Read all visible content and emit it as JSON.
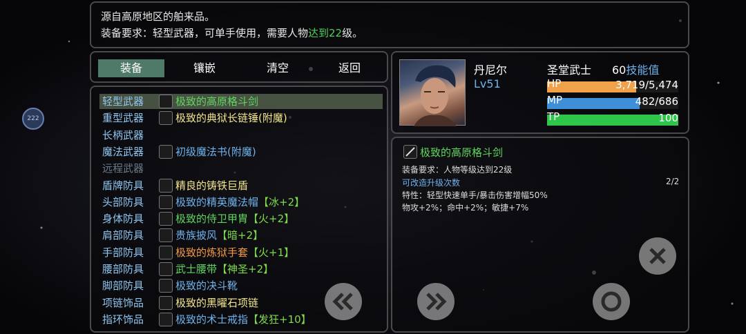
{
  "description": {
    "line1": "源自高原地区的舶来品。",
    "line2_prefix": "装备要求：轻型武器，可单手使用，需要人物",
    "line2_green": "达到22",
    "line2_suffix": "级。"
  },
  "tabs": {
    "equip": "装备",
    "inlay": "镶嵌",
    "clear": "清空",
    "back": "返回"
  },
  "side_badge": "222",
  "slots": [
    {
      "slot": "轻型武器",
      "item": "极致的高原格斗剑",
      "color": "c-green"
    },
    {
      "slot": "重型武器",
      "item": "极致的典狱长链锤(附魔)",
      "color": "c-yellow"
    },
    {
      "slot": "长柄武器",
      "item": "",
      "color": "c-white"
    },
    {
      "slot": "魔法武器",
      "item": "初级魔法书(附魔)",
      "color": "c-blue"
    },
    {
      "slot": "远程武器",
      "item": "",
      "color": "c-white"
    },
    {
      "slot": "盾牌防具",
      "item": "精良的铸铁巨盾",
      "color": "c-yellow"
    },
    {
      "slot": "头部防具",
      "item": "极致的精英魔法帽",
      "suffix": "【冰+2】",
      "color": "c-blue"
    },
    {
      "slot": "身体防具",
      "item": "极致的侍卫甲胄",
      "suffix": "【火+2】",
      "color": "c-green"
    },
    {
      "slot": "肩部防具",
      "item": "贵族披风",
      "suffix": "【暗+2】",
      "color": "c-blue"
    },
    {
      "slot": "手部防具",
      "item": "极致的炼狱手套",
      "suffix": "【火+1】",
      "color": "c-orange"
    },
    {
      "slot": "腰部防具",
      "item": "武士腰带",
      "suffix": "【神圣+2】",
      "color": "c-green"
    },
    {
      "slot": "脚部防具",
      "item": "极致的决斗靴",
      "color": "c-blue"
    },
    {
      "slot": "项链饰品",
      "item": "极致的黑曜石项链",
      "color": "c-yellow"
    },
    {
      "slot": "指环饰品",
      "item": "极致的术士戒指",
      "suffix": "【发狂+10】",
      "color": "c-blue"
    }
  ],
  "character": {
    "name": "丹尼尔",
    "class": "圣堂武士",
    "skill_points": "60",
    "skill_label": "技能值",
    "level": "Lv51",
    "hp_label": "HP",
    "hp_value": "3,719/5,474",
    "hp_ratio": 0.679,
    "mp_label": "MP",
    "mp_value": "482/686",
    "mp_ratio": 0.703,
    "tp_label": "TP",
    "tp_value": "100",
    "tp_ratio": 1.0
  },
  "detail": {
    "item_name": "极致的高原格斗剑",
    "requirement": "装备要求：人物等级达到22级",
    "upgrade_label": "可改造升级次数",
    "upgrade_count": "2/2",
    "trait": "特性：轻型快速单手/暴击伤害增幅50%",
    "stats": "物攻+2%；命中+2%；敏捷+7%"
  },
  "colors": {
    "hp_bar": "#f0a24a",
    "mp_bar": "#3f8fd8",
    "tp_bar": "#2fc44a",
    "tab_active": "#4f7a6a",
    "selected_row": "#6f8a66"
  }
}
